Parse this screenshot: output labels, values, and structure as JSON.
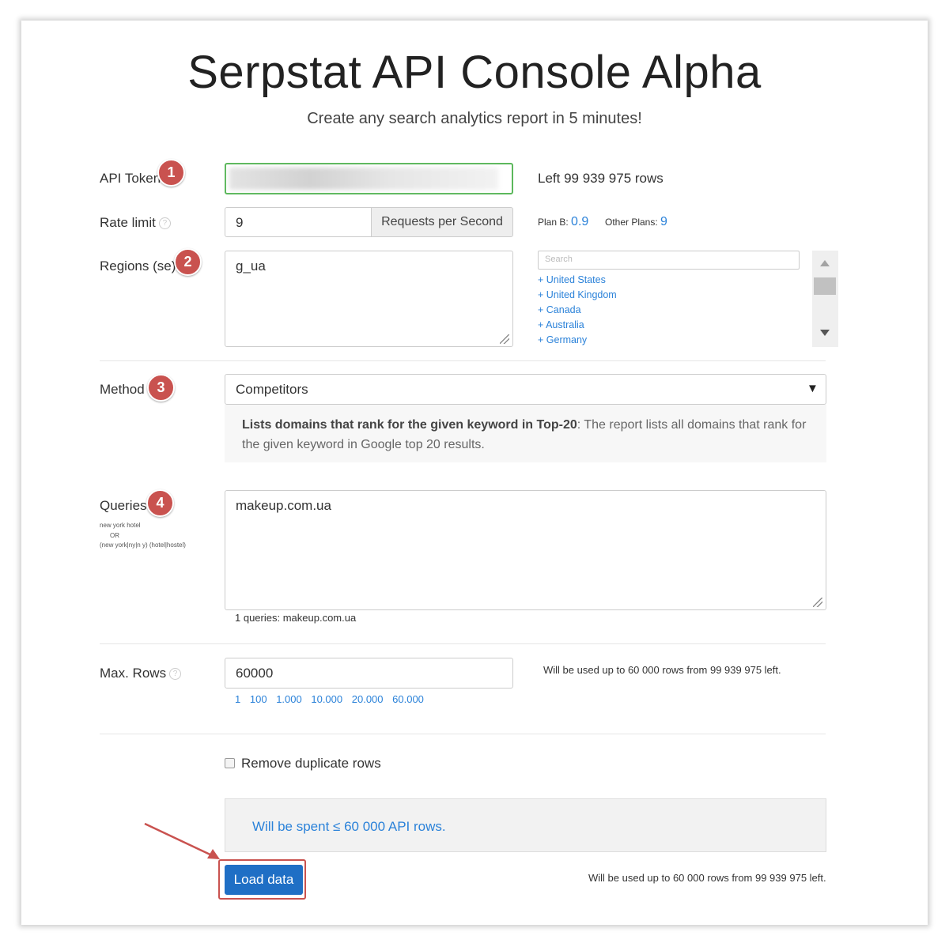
{
  "header": {
    "title": "Serpstat API Console Alpha",
    "subtitle": "Create any search analytics report in 5 minutes!"
  },
  "token": {
    "label": "API Token",
    "badge": "1",
    "rows_left": "Left 99 939 975 rows"
  },
  "rate": {
    "label": "Rate limit",
    "value": "9",
    "unit": "Requests per Second",
    "plan_b_label": "Plan B:",
    "plan_b_value": "0.9",
    "other_label": "Other Plans:",
    "other_value": "9"
  },
  "regions": {
    "label": "Regions (se)",
    "badge": "2",
    "value": "g_ua",
    "search_placeholder": "Search",
    "items": [
      "+ United States",
      "+ United Kingdom",
      "+ Canada",
      "+ Australia",
      "+ Germany"
    ]
  },
  "method": {
    "label": "Method",
    "badge": "3",
    "selected": "Competitors",
    "desc_bold": "Lists domains that rank for the given keyword in Top-20",
    "desc_text": ": The report lists all domains that rank for the given keyword in Google top 20 results."
  },
  "queries": {
    "label": "Queries",
    "badge": "4",
    "hint1": "new york hotel",
    "hint2": "OR",
    "hint3": "(new york|ny|n y) (hotel|hostel)",
    "value": "makeup.com.ua",
    "summary": "1 queries: makeup.com.ua"
  },
  "maxrows": {
    "label": "Max. Rows",
    "value": "60000",
    "presets": [
      "1",
      "100",
      "1.000",
      "10.000",
      "20.000",
      "60.000"
    ],
    "note": "Will be used up to 60 000 rows from 99 939 975 left."
  },
  "options": {
    "remove_duplicates": "Remove duplicate rows"
  },
  "spend": {
    "text": "Will be spent ≤ 60 000 API rows."
  },
  "actions": {
    "load": "Load data",
    "note": "Will be used up to 60 000 rows from 99 939 975 left."
  },
  "colors": {
    "accent": "#2b82d9",
    "badge": "#c9524f",
    "button": "#1f6fc5",
    "highlight": "#c9524f",
    "token_border": "#5cb85c"
  },
  "icons": {
    "help": "help-circle-icon",
    "dropdown": "triangle-down-icon",
    "scroll_up": "arrow-up-icon",
    "scroll_down": "arrow-down-icon",
    "pointer": "arrow-icon"
  }
}
